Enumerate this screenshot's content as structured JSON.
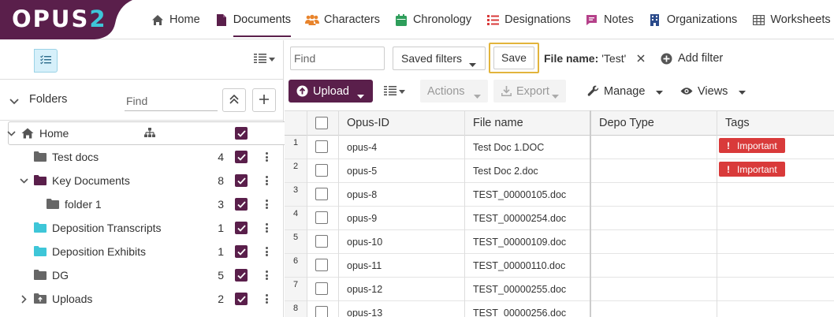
{
  "app": {
    "logo_main": "OPUS",
    "logo_accent": "2",
    "brand_color": "#5a1f4b",
    "accent_color": "#3ec6d8"
  },
  "nav": {
    "items": [
      {
        "label": "Home",
        "icon": "home-icon",
        "active": false
      },
      {
        "label": "Documents",
        "icon": "document-icon",
        "active": true
      },
      {
        "label": "Characters",
        "icon": "people-icon",
        "active": false
      },
      {
        "label": "Chronology",
        "icon": "calendar-icon",
        "active": false
      },
      {
        "label": "Designations",
        "icon": "list-icon",
        "active": false
      },
      {
        "label": "Notes",
        "icon": "note-icon",
        "active": false
      },
      {
        "label": "Organizations",
        "icon": "building-icon",
        "active": false
      },
      {
        "label": "Worksheets",
        "icon": "grid-icon",
        "active": false
      }
    ]
  },
  "left_panel": {
    "folders_title": "Folders",
    "find_placeholder": "Find",
    "tree": [
      {
        "name": "Home",
        "count": "",
        "level": 0,
        "icon": "home-icon",
        "expander": "expanded",
        "color": "#555555",
        "show_kebab": false
      },
      {
        "name": "Test docs",
        "count": "4",
        "level": 1,
        "icon": "folder-icon",
        "expander": "none",
        "color": "#666666",
        "show_kebab": true
      },
      {
        "name": "Key Documents",
        "count": "8",
        "level": 1,
        "icon": "folder-icon",
        "expander": "expanded",
        "color": "#5a1f4b",
        "show_kebab": true
      },
      {
        "name": "folder 1",
        "count": "3",
        "level": 2,
        "icon": "folder-icon",
        "expander": "none",
        "color": "#666666",
        "show_kebab": true
      },
      {
        "name": "Deposition Transcripts",
        "count": "1",
        "level": 1,
        "icon": "folder-icon",
        "expander": "none",
        "color": "#3ec6d8",
        "show_kebab": true
      },
      {
        "name": "Deposition Exhibits",
        "count": "1",
        "level": 1,
        "icon": "folder-icon",
        "expander": "none",
        "color": "#3ec6d8",
        "show_kebab": true
      },
      {
        "name": "DG",
        "count": "5",
        "level": 1,
        "icon": "folder-icon",
        "expander": "none",
        "color": "#666666",
        "show_kebab": true
      },
      {
        "name": "Uploads",
        "count": "2",
        "level": 1,
        "icon": "upload-folder-icon",
        "expander": "collapsed",
        "color": "#666666",
        "show_kebab": true
      }
    ]
  },
  "filters": {
    "find_placeholder": "Find",
    "saved_filters_label": "Saved filters",
    "save_label": "Save",
    "chip_key": "File name:",
    "chip_value": "'Test'",
    "add_filter_label": "Add filter"
  },
  "actions": {
    "upload_label": "Upload",
    "actions_label": "Actions",
    "export_label": "Export",
    "manage_label": "Manage",
    "views_label": "Views"
  },
  "table": {
    "columns": [
      "Opus-ID",
      "File name",
      "Depo Type",
      "Tags"
    ],
    "rows": [
      {
        "num": "1",
        "id": "opus-4",
        "file": "Test Doc 1.DOC",
        "depo": "",
        "tag": "Important"
      },
      {
        "num": "2",
        "id": "opus-5",
        "file": "Test Doc 2.doc",
        "depo": "",
        "tag": "Important"
      },
      {
        "num": "3",
        "id": "opus-8",
        "file": "TEST_00000105.doc",
        "depo": "",
        "tag": ""
      },
      {
        "num": "4",
        "id": "opus-9",
        "file": "TEST_00000254.doc",
        "depo": "",
        "tag": ""
      },
      {
        "num": "5",
        "id": "opus-10",
        "file": "TEST_00000109.doc",
        "depo": "",
        "tag": ""
      },
      {
        "num": "6",
        "id": "opus-11",
        "file": "TEST_00000110.doc",
        "depo": "",
        "tag": ""
      },
      {
        "num": "7",
        "id": "opus-12",
        "file": "TEST_00000255.doc",
        "depo": "",
        "tag": ""
      },
      {
        "num": "8",
        "id": "opus-13",
        "file": "TEST_00000256.doc",
        "depo": "",
        "tag": ""
      }
    ],
    "tag_color": "#d93a3a"
  }
}
